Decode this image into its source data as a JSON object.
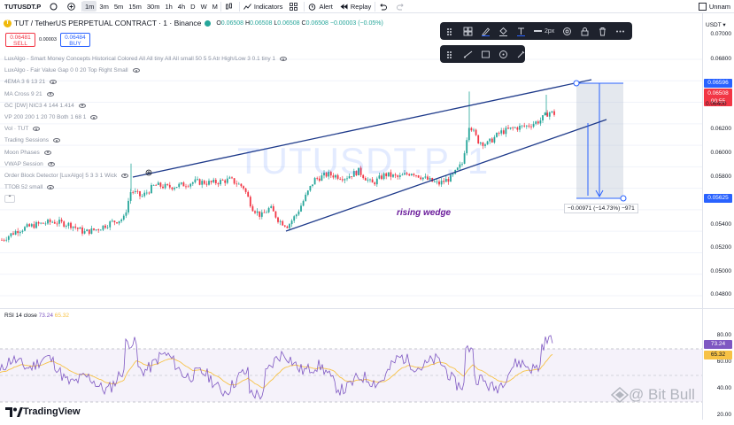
{
  "topbar": {
    "symbol": "TUTUSDT.P",
    "timeframes": [
      "1m",
      "3m",
      "5m",
      "15m",
      "30m",
      "1h",
      "4h",
      "D",
      "W",
      "M"
    ],
    "active_timeframe": "1m",
    "indicators_label": "Indicators",
    "alert_label": "Alert",
    "replay_label": "Replay",
    "layout_label": "Unnam"
  },
  "header": {
    "title": "TUT / TetherUS PERPETUAL CONTRACT · 1 · Binance",
    "coin_glyph": "T",
    "ohlc": {
      "o_label": "O",
      "o": "0.06508",
      "h_label": "H",
      "h": "0.06508",
      "l_label": "L",
      "l": "0.06508",
      "c_label": "C",
      "c": "0.06508",
      "change": "−0.00003 (−0.05%)"
    }
  },
  "trade": {
    "sell_price": "0.06481",
    "sell_label": "SELL",
    "spread": "0.00003",
    "buy_price": "0.06484",
    "buy_label": "BUY"
  },
  "indicators": [
    "LuxAlgo - Smart Money Concepts Historical Colored All All tiny All All small 50 5 5 Atr High/Low 3 0.1 tiny 1",
    "LuxAlgo - Fair Value Gap 0 0 20 Top Right Small",
    "4EMA 3 6 13 21",
    "MA Cross 9 21",
    "GC [DW] NIC3 4 144 1.414",
    "VP 200 200 1 20 70 Both 1 68 1",
    "Vol · TUT",
    "Trading Sessions",
    "Moon Phases",
    "VWAP Session",
    "Order Block Detector [LuxAlgo] 5 3 3 1 Wick",
    "TTOB 52 small"
  ],
  "toolbar": {
    "width_label": "2px"
  },
  "price_axis": {
    "currency": "USDT",
    "ticks": [
      "0.07000",
      "0.06800",
      "0.06400",
      "0.06200",
      "0.06000",
      "0.05800",
      "0.05400",
      "0.05200",
      "0.05000",
      "0.04800"
    ],
    "target_tag": "0.06596",
    "current_tag": "0.06508",
    "countdown": "00:55",
    "lower_tag": "0.05625"
  },
  "annotations": {
    "watermark": "TUTUSDT.P, 1",
    "pattern": "rising wedge",
    "measure": "−0.00971 (−14.73%) −971"
  },
  "rsi": {
    "title": "RSI 14 close",
    "value": "73.24",
    "ma": "65.32",
    "ticks": [
      "80.00",
      "60.00",
      "40.00",
      "20.00"
    ],
    "tag_value": "73.24",
    "tag_ma": "65.32"
  },
  "footer": {
    "logo": "TradingView",
    "watermark": "@ Bit Bull"
  },
  "colors": {
    "up": "#26a69a",
    "down": "#f23645",
    "wedge": "#1e3a8a",
    "rsi": "#7e57c2",
    "rsi_ma": "#f7c245",
    "accent": "#2962ff"
  }
}
